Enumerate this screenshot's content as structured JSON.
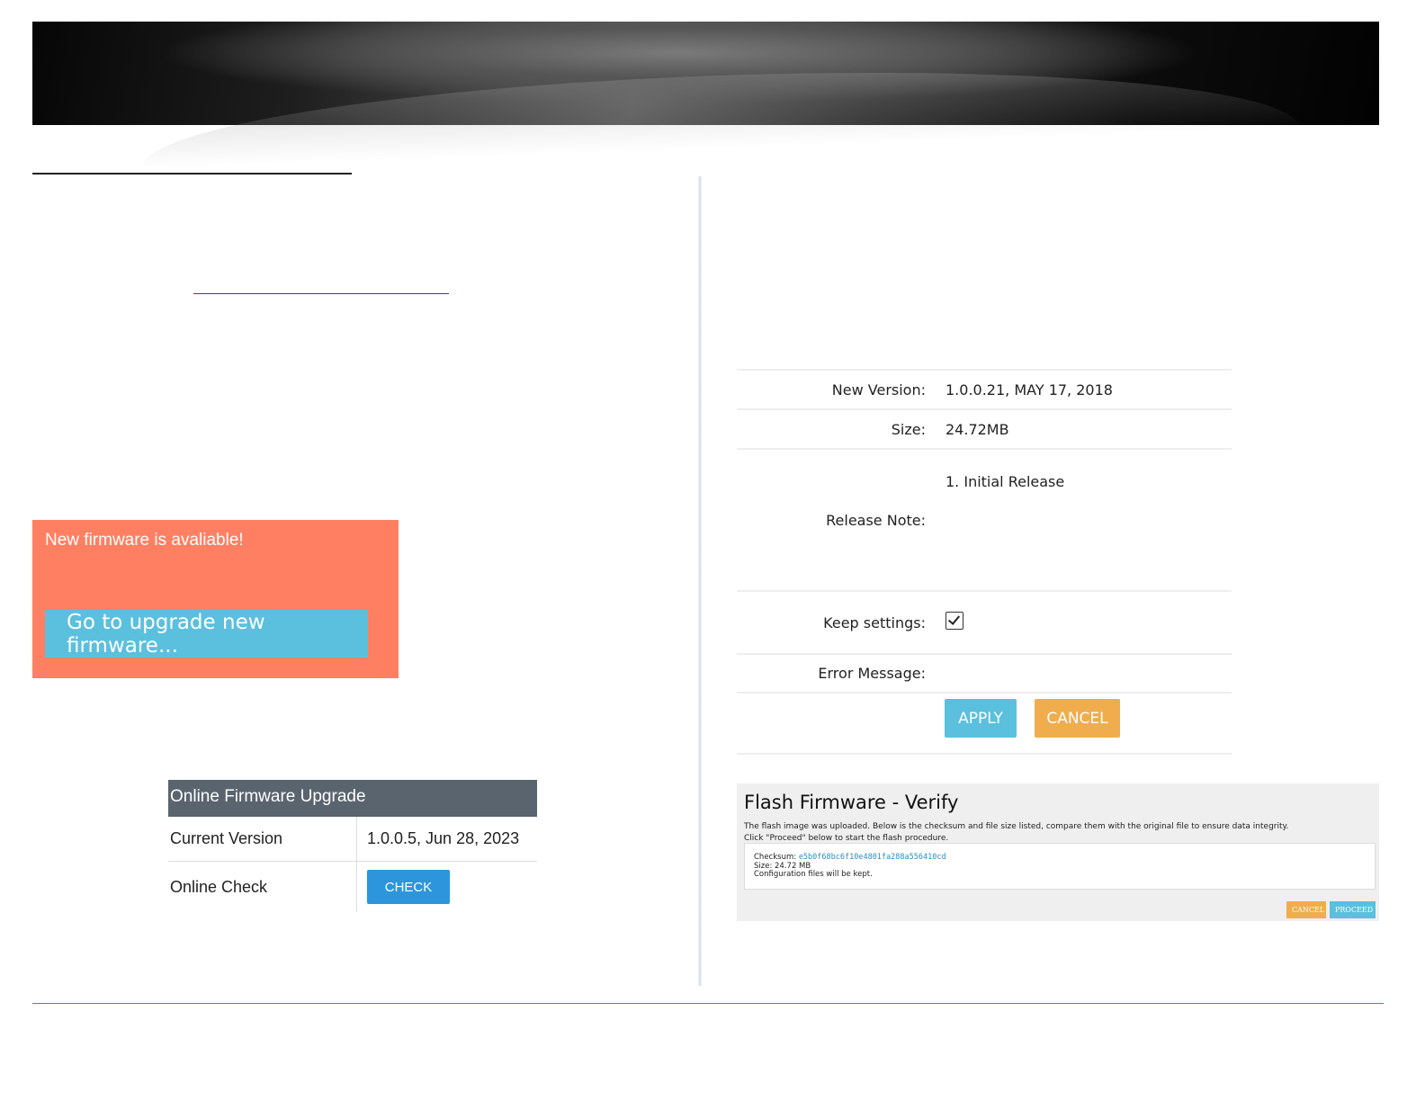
{
  "alert": {
    "message": "New firmware is avaliable!",
    "button_label": "Go to upgrade new firmware..."
  },
  "online_upgrade": {
    "title": "Online Firmware Upgrade",
    "current_version_label": "Current Version",
    "current_version_value": "1.0.0.5, Jun 28, 2023",
    "online_check_label": "Online Check",
    "check_button": "CHECK"
  },
  "upgrade_form": {
    "new_version_label": "New Version:",
    "new_version_value": "1.0.0.21, MAY 17, 2018",
    "size_label": "Size:",
    "size_value": "24.72MB",
    "release_note_label": "Release Note:",
    "release_note_value": "1. Initial Release",
    "keep_settings_label": "Keep settings:",
    "keep_settings_checked": true,
    "error_message_label": "Error Message:",
    "error_message_value": "",
    "apply_button": "APPLY",
    "cancel_button": "CANCEL"
  },
  "flash_verify": {
    "title": "Flash Firmware - Verify",
    "description_line1": "The flash image was uploaded. Below is the checksum and file size listed, compare them with the original file to ensure data integrity.",
    "description_line2": "Click \"Proceed\" below to start the flash procedure.",
    "checksum_label": "Checksum:",
    "checksum_value": "e5b0f68bc6f10e4801fa288a556410cd",
    "size_text": "Size: 24.72 MB",
    "config_text": "Configuration files will be kept.",
    "cancel_button": "CANCEL",
    "proceed_button": "PROCEED"
  },
  "colors": {
    "alert_bg": "#ff7f63",
    "info_blue": "#5bc0de",
    "warning_orange": "#f0ad4e",
    "primary_blue": "#2d95dc",
    "table_header": "#5a646f"
  }
}
